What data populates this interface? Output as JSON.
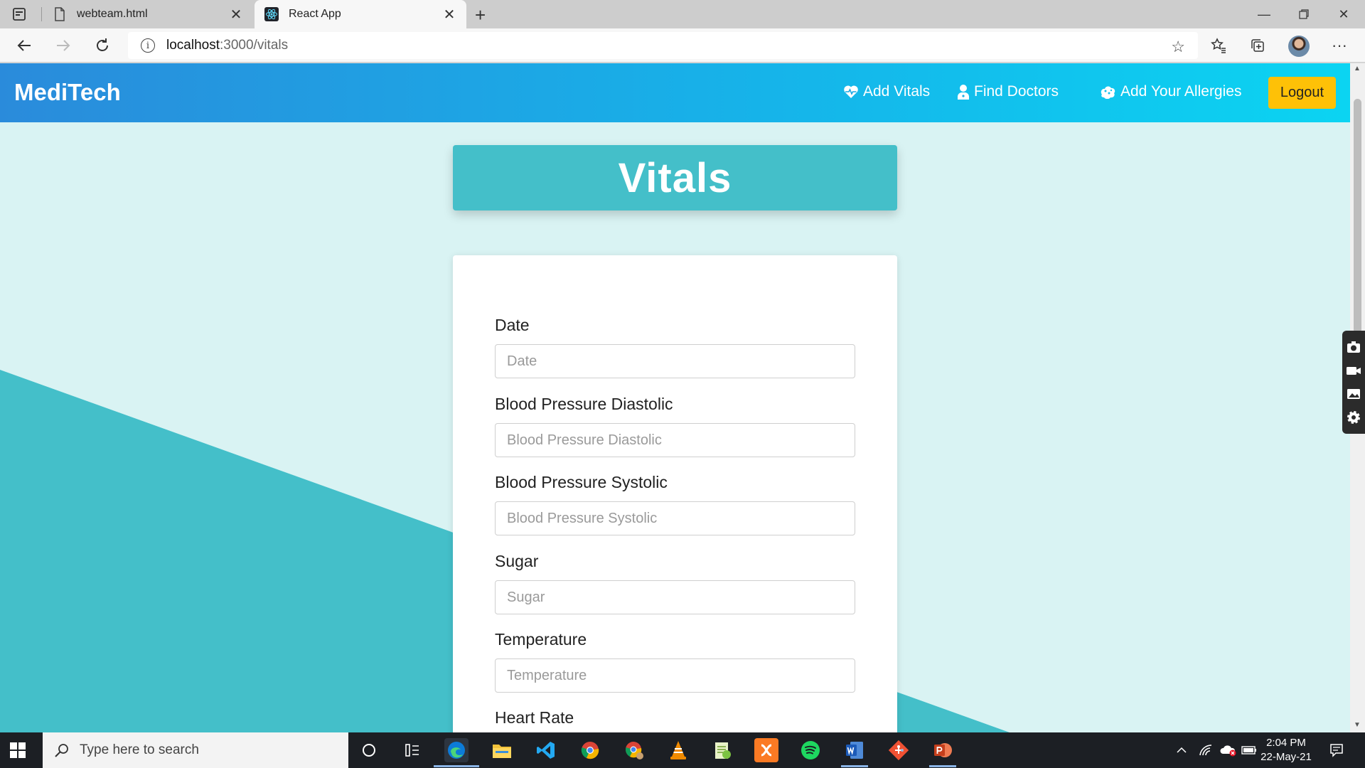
{
  "browser": {
    "tabs": [
      {
        "title": "webteam.html"
      },
      {
        "title": "React App"
      }
    ],
    "url_host": "localhost",
    "url_path": ":3000/vitals"
  },
  "navbar": {
    "brand": "MediTech",
    "links": [
      {
        "label": "Add Vitals",
        "icon": "heartbeat-icon"
      },
      {
        "label": "Find Doctors",
        "icon": "doctor-icon"
      },
      {
        "label": "Add Your Allergies",
        "icon": "allergies-icon"
      }
    ],
    "logout_label": "Logout",
    "colors": {
      "gradient_start": "#2a8bdb",
      "gradient_end": "#0bd4f2",
      "logout": "#fec107"
    }
  },
  "page": {
    "heading": "Vitals",
    "colors": {
      "background": "#d9f3f3",
      "accent": "#44bfc9"
    }
  },
  "form": {
    "fields": [
      {
        "label": "Date",
        "placeholder": "Date"
      },
      {
        "label": "Blood Pressure Diastolic",
        "placeholder": "Blood Pressure Diastolic"
      },
      {
        "label": "Blood Pressure Systolic",
        "placeholder": "Blood Pressure Systolic"
      },
      {
        "label": "Sugar",
        "placeholder": "Sugar"
      },
      {
        "label": "Temperature",
        "placeholder": "Temperature"
      },
      {
        "label": "Heart Rate"
      }
    ]
  },
  "taskbar": {
    "search_placeholder": "Type here to search",
    "time": "2:04 PM",
    "date": "22-May-21",
    "apps": [
      "cortana-icon",
      "task-view-icon",
      "edge-icon",
      "file-explorer-icon",
      "vscode-icon",
      "chrome-icon",
      "chrome-profile-icon",
      "vlc-icon",
      "notepad-plus-icon",
      "xampp-icon",
      "spotify-icon",
      "word-icon",
      "git-icon",
      "powerpoint-icon"
    ]
  }
}
